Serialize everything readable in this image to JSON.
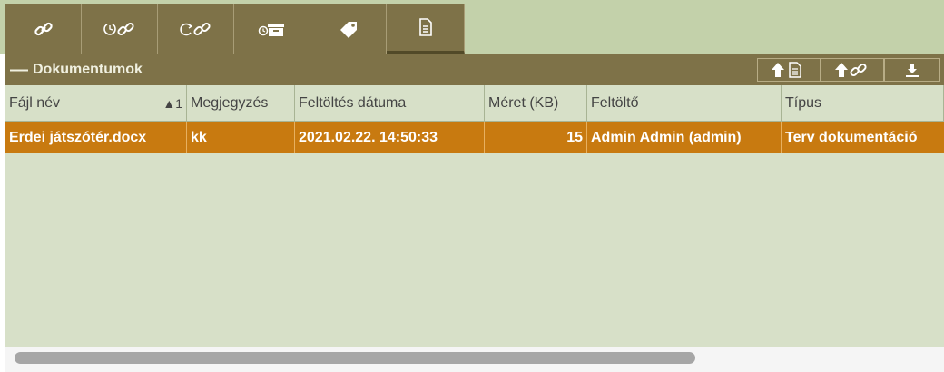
{
  "tabs": [
    {
      "icon": "link-icon"
    },
    {
      "icon": "history-link-icon"
    },
    {
      "icon": "refresh-link-icon"
    },
    {
      "icon": "archive-icon"
    },
    {
      "icon": "tag-icon"
    },
    {
      "icon": "document-icon",
      "active": true
    }
  ],
  "panel": {
    "collapse_symbol": "—",
    "title": "Dokumentumok",
    "buttons": [
      {
        "icon": "upload-document-icon"
      },
      {
        "icon": "upload-link-icon"
      },
      {
        "icon": "download-icon"
      }
    ]
  },
  "table": {
    "columns": [
      "Fájl név",
      "Megjegyzés",
      "Feltöltés dátuma",
      "Méret (KB)",
      "Feltöltő",
      "Típus"
    ],
    "sort_indicator": "▲1",
    "rows": [
      [
        "Erdei játszótér.docx",
        "kk",
        "2021.02.22. 14:50:33",
        "15",
        "Admin Admin (admin)",
        "Terv dokumentáció"
      ]
    ]
  },
  "colors": {
    "accent": "#7e7248",
    "selected_row": "#c87a10",
    "panel_bg": "#d7e0c8"
  }
}
